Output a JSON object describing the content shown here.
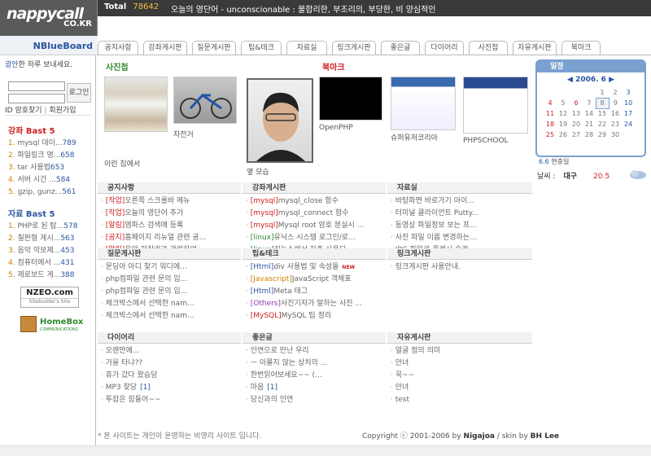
{
  "logo": {
    "title": "nappycall",
    "sub": "CO.KR",
    "board": "NBlueBoard"
  },
  "total": {
    "label": "Total",
    "count": "78642"
  },
  "word": {
    "text": "오늘의 영단어 - unconscionable : 불합리한, 부조리의, 부당한, 비 양심적인"
  },
  "tabs": [
    "공지사항",
    "강좌게시판",
    "질문게시판",
    "팁&테크",
    "자료실",
    "링크게시판",
    "좋은글",
    "다이어리",
    "사진첩",
    "자유게시판",
    "북마크"
  ],
  "login": {
    "msg_a": "광안",
    "msg_b": "한 하루 보내세요.",
    "btn": "로그인",
    "find": "ID 암호찾기",
    "join": "회원가입"
  },
  "lecture": {
    "title": "강좌 Bast 5",
    "items": [
      {
        "no": "1.",
        "t": "mysql 데이...",
        "c": "789"
      },
      {
        "no": "2.",
        "t": "파일링크 명...",
        "c": "658"
      },
      {
        "no": "3.",
        "t": "tar 사용법",
        "c": "653"
      },
      {
        "no": "4.",
        "t": "서버 시간 ...",
        "c": "584"
      },
      {
        "no": "5.",
        "t": "gzip, gunz...",
        "c": "561"
      }
    ]
  },
  "data_best": {
    "title": "자료 Bast 5",
    "items": [
      {
        "no": "1.",
        "t": "PHP로 된 탐...",
        "c": "578"
      },
      {
        "no": "2.",
        "t": "칠판형 게시...",
        "c": "563"
      },
      {
        "no": "3.",
        "t": "음악 악보제...",
        "c": "453"
      },
      {
        "no": "4.",
        "t": "컴퓨터에서 ...",
        "c": "431"
      },
      {
        "no": "5.",
        "t": "제로보드 게...",
        "c": "388"
      }
    ]
  },
  "banner1": {
    "a": "NZEO.com",
    "b": "Sitebuilder's Site"
  },
  "banner2": {
    "a": "HomeBox",
    "b": "COMMUNICATIONS"
  },
  "photo": {
    "title": "사진첩",
    "caps": [
      "이런 집에서",
      "자전거",
      "옆 모습"
    ]
  },
  "bookmark": {
    "title": "북마크",
    "caps": [
      "OpenPHP",
      "슈퍼유저코리아",
      "PHPSCHOOL"
    ]
  },
  "boards": [
    {
      "title": "공지사항",
      "items": [
        [
          "[작업]",
          "오른쪽 스크롤바 메뉴",
          "r"
        ],
        [
          "[작업]",
          "오늘의 영단어 추가",
          "r"
        ],
        [
          "[알림]",
          "엠파스 검색에 등록",
          "r"
        ],
        [
          "[공지]",
          "홈페이지 리뉴얼 관련 공...",
          "r"
        ],
        [
          "[알림]",
          "음악 저작권과 관련하여~...",
          "r"
        ]
      ]
    },
    {
      "title": "강좌게시판",
      "items": [
        [
          "[mysql]",
          "mysql_close 함수",
          "r"
        ],
        [
          "[mysql]",
          "mysql_connect 함수",
          "r"
        ],
        [
          "[mysql]",
          "Mysql root 암호 분실시 ...",
          "r"
        ],
        [
          "[linux]",
          "유닉스 시스템 로그인/로...",
          "g"
        ],
        [
          "[linux]",
          "리눅스에서 자주 사용되...",
          "g"
        ]
      ]
    },
    {
      "title": "자료실",
      "items": [
        [
          "",
          "바탕화면 바로가기 아이...",
          ""
        ],
        [
          "",
          "터미널 클라이언트 Putty...",
          ""
        ],
        [
          "",
          "동영상 파일정보 보는 프...",
          ""
        ],
        [
          "",
          "사진 파일 이름 변경하는...",
          ""
        ],
        [
          "",
          "JPG 파일로 플래시 슬라...",
          ""
        ]
      ]
    },
    {
      "title": "질문게시판",
      "items": [
        [
          "",
          "문딩아 아디 찾기 워디에...",
          ""
        ],
        [
          "",
          "php컴파일 관련 문의 입...",
          ""
        ],
        [
          "",
          "php컴파일 관련 문의 입...",
          ""
        ],
        [
          "",
          "체크박스에서 선택한 nam...",
          ""
        ],
        [
          "",
          "체크박스에서 선택한 nam...",
          ""
        ]
      ]
    },
    {
      "title": "팁&테크",
      "items": [
        [
          "[Html]",
          "div 사용법 및 속성들",
          "b",
          "NEW"
        ],
        [
          "[Javascript]",
          "JavaScript 객체표",
          "o"
        ],
        [
          "[Html]",
          "Meta 태그",
          "b"
        ],
        [
          "[Others]",
          "사진기자가 말하는 사진 ...",
          "p"
        ],
        [
          "[MySQL]",
          "MySQL 팁 정리",
          "r"
        ]
      ]
    },
    {
      "title": "링크게시판",
      "items": [
        [
          "",
          "링크게시판 사용안내.",
          ""
        ]
      ]
    },
    {
      "title": "다이어리",
      "items": [
        [
          "",
          "오랜만에...",
          ""
        ],
        [
          "",
          "가을 타냐??",
          ""
        ],
        [
          "",
          "휴가 갔다 왔습당",
          ""
        ],
        [
          "",
          "MP3 찾당",
          "",
          "[1]"
        ],
        [
          "",
          "투잡은 힘들어~~",
          ""
        ]
      ]
    },
    {
      "title": "좋은글",
      "items": [
        [
          "",
          "인연으로 만난 우리",
          ""
        ],
        [
          "",
          "ㅡ 아물지 않는 상처의 ...",
          ""
        ],
        [
          "",
          "한번읽어보세요~~ (...",
          ""
        ],
        [
          "",
          "마음",
          "",
          "[1]"
        ],
        [
          "",
          "당신과의 인연",
          ""
        ]
      ]
    },
    {
      "title": "자유게시판",
      "items": [
        [
          "",
          "얼굴 점의 의미",
          ""
        ],
        [
          "",
          "안녀",
          ""
        ],
        [
          "",
          "꾹~~",
          ""
        ],
        [
          "",
          "안녀",
          ""
        ],
        [
          "",
          "test",
          ""
        ]
      ]
    }
  ],
  "calendar": {
    "title": "일정",
    "month": "2006. 6",
    "weeks": [
      [
        "",
        "",
        "",
        "",
        "1",
        "2",
        "3"
      ],
      [
        "4",
        "5",
        "6",
        "7",
        "8",
        "9",
        "10"
      ],
      [
        "11",
        "12",
        "13",
        "14",
        "15",
        "16",
        "17"
      ],
      [
        "18",
        "19",
        "20",
        "21",
        "22",
        "23",
        "24"
      ],
      [
        "25",
        "26",
        "27",
        "28",
        "29",
        "30",
        ""
      ]
    ],
    "today": "8",
    "footer_date": "6.6",
    "footer_text": "현충일"
  },
  "weather": {
    "label": "날씨 :",
    "city": "대구",
    "temp": "20.5"
  },
  "footer": {
    "note": "* 본 사이트는 개인이 운영하는 비영리 사이트 입니다.",
    "copy_a": "Copyright ⓒ 2001-2006 by",
    "copy_b": "Nigajoa",
    "copy_c": "/ skin by",
    "copy_d": "BH Lee"
  }
}
